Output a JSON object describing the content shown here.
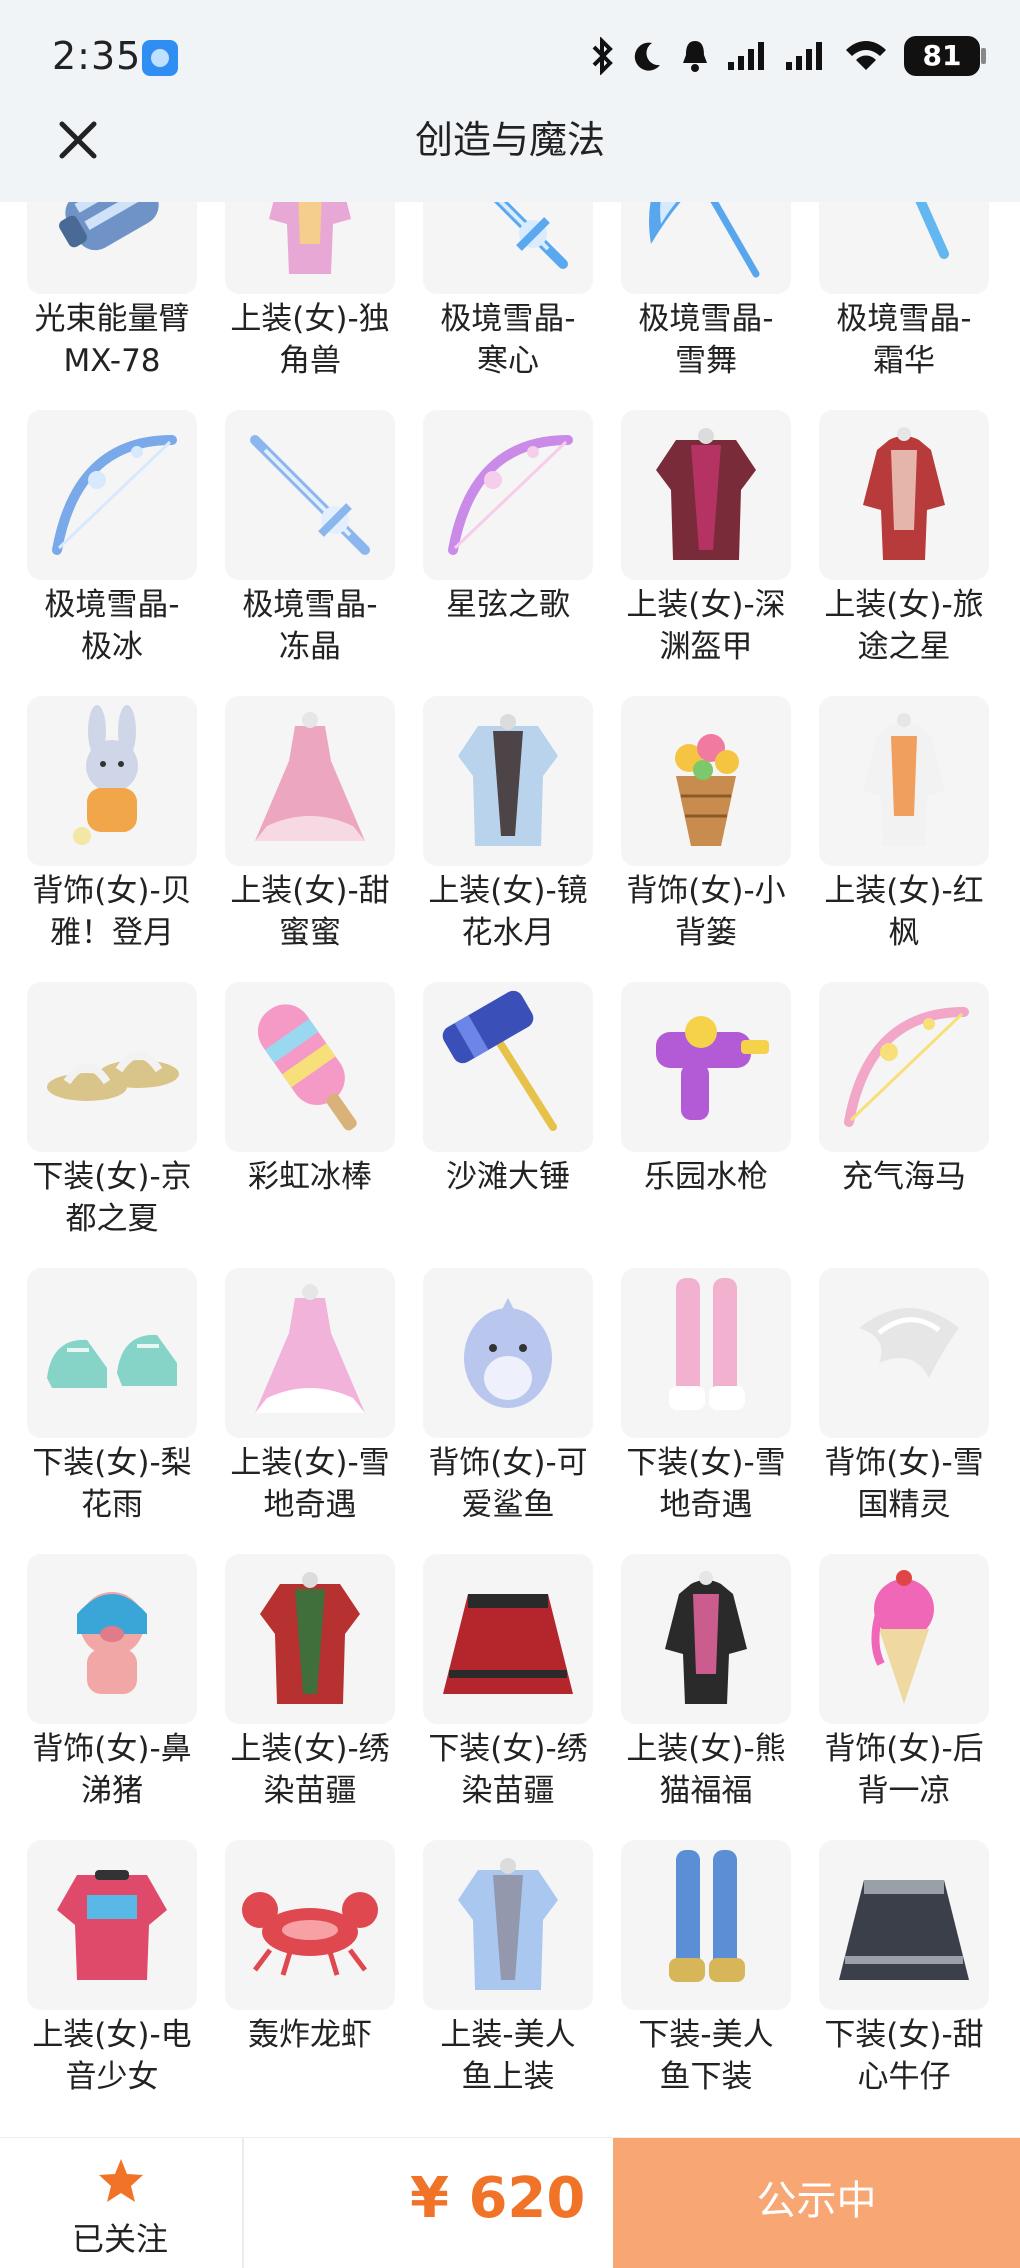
{
  "status_bar": {
    "time": "2:35",
    "battery": "81"
  },
  "header": {
    "title": "创造与魔法"
  },
  "items": [
    {
      "name": "光束能量臂\nMX-78",
      "icon": "gauntlet",
      "color": "#6f93c6",
      "accent": "#cfe2f7"
    },
    {
      "name": "上装(女)-独\n角兽",
      "icon": "outfit",
      "color": "#e8a8d6",
      "accent": "#f7d77a"
    },
    {
      "name": "极境雪晶-\n寒心",
      "icon": "sword",
      "color": "#5aa8f0",
      "accent": "#d9ecff"
    },
    {
      "name": "极境雪晶-\n雪舞",
      "icon": "scythe",
      "color": "#58a6ee",
      "accent": "#d6eaff"
    },
    {
      "name": "极境雪晶-\n霜华",
      "icon": "crossbow",
      "color": "#62b7f0",
      "accent": "#d8eefe"
    },
    {
      "name": "极境雪晶-\n极冰",
      "icon": "bow",
      "color": "#7aa9ea",
      "accent": "#d9e9fd"
    },
    {
      "name": "极境雪晶-\n冻晶",
      "icon": "sword",
      "color": "#8bb7ee",
      "accent": "#e3efff"
    },
    {
      "name": "星弦之歌",
      "icon": "bow",
      "color": "#c98ae8",
      "accent": "#f6cdea"
    },
    {
      "name": "上装(女)-深\n渊盔甲",
      "icon": "armor",
      "color": "#7a2b3a",
      "accent": "#c0356a"
    },
    {
      "name": "上装(女)-旅\n途之星",
      "icon": "outfit",
      "color": "#b73b3b",
      "accent": "#f0d4c8"
    },
    {
      "name": "背饰(女)-贝\n雅！登月",
      "icon": "bunny",
      "color": "#cfd6e8",
      "accent": "#f1a64a"
    },
    {
      "name": "上装(女)-甜\n蜜蜜",
      "icon": "dress",
      "color": "#eca6bf",
      "accent": "#f7d9e4"
    },
    {
      "name": "上装(女)-镜\n花水月",
      "icon": "armor",
      "color": "#b9d3ec",
      "accent": "#3a2a2a"
    },
    {
      "name": "背饰(女)-小\n背篓",
      "icon": "basket",
      "color": "#c98c4f",
      "accent": "#f5c542"
    },
    {
      "name": "上装(女)-红\n枫",
      "icon": "outfit",
      "color": "#f2f2f2",
      "accent": "#f08a3a"
    },
    {
      "name": "下装(女)-京\n都之夏",
      "icon": "sandals",
      "color": "#d9c48a",
      "accent": "#f2f2f2"
    },
    {
      "name": "彩虹冰棒",
      "icon": "popsicle",
      "color": "#f59ac6",
      "accent": "#9ad8f0"
    },
    {
      "name": "沙滩大锤",
      "icon": "hammer",
      "color": "#3b4fb8",
      "accent": "#e7c24a"
    },
    {
      "name": "乐园水枪",
      "icon": "watergun",
      "color": "#b35bd6",
      "accent": "#f6d24a"
    },
    {
      "name": "充气海马",
      "icon": "bow",
      "color": "#f2a6c8",
      "accent": "#f7e07a"
    },
    {
      "name": "下装(女)-梨\n花雨",
      "icon": "shoes",
      "color": "#86d3c7",
      "accent": "#e9f7f4"
    },
    {
      "name": "上装(女)-雪\n地奇遇",
      "icon": "dress",
      "color": "#f1b3da",
      "accent": "#ffffff"
    },
    {
      "name": "背饰(女)-可\n爱鲨鱼",
      "icon": "shark",
      "color": "#b9c6ee",
      "accent": "#eef1fb"
    },
    {
      "name": "下装(女)-雪\n地奇遇",
      "icon": "legs",
      "color": "#f2b2cf",
      "accent": "#ffffff"
    },
    {
      "name": "背饰(女)-雪\n国精灵",
      "icon": "wings",
      "color": "#e6e6e6",
      "accent": "#ffffff"
    },
    {
      "name": "背饰(女)-鼻\n涕猪",
      "icon": "pig",
      "color": "#f2a7a7",
      "accent": "#3aa6d8"
    },
    {
      "name": "上装(女)-绣\n染苗疆",
      "icon": "armor",
      "color": "#b6312f",
      "accent": "#2b7a3e"
    },
    {
      "name": "下装(女)-绣\n染苗疆",
      "icon": "skirt",
      "color": "#b4262b",
      "accent": "#2a2a2a"
    },
    {
      "name": "上装(女)-熊\n猫福福",
      "icon": "outfit",
      "color": "#2a2a2a",
      "accent": "#f26aa8"
    },
    {
      "name": "背饰(女)-后\n背一凉",
      "icon": "icecream",
      "color": "#f067b7",
      "accent": "#f0d9a0"
    },
    {
      "name": "上装(女)-电\n音少女",
      "icon": "jacket",
      "color": "#e04a6a",
      "accent": "#5ab8e6"
    },
    {
      "name": "轰炸龙虾",
      "icon": "lobster",
      "color": "#e0484f",
      "accent": "#f7a1a5"
    },
    {
      "name": "上装-美人\n鱼上装",
      "icon": "armor",
      "color": "#a9c7ef",
      "accent": "#8f8fa0"
    },
    {
      "name": "下装-美人\n鱼下装",
      "icon": "legs",
      "color": "#5a8fd6",
      "accent": "#d7b65a"
    },
    {
      "name": "下装(女)-甜\n心牛仔",
      "icon": "skirt",
      "color": "#3a3f4a",
      "accent": "#9aa0a8"
    }
  ],
  "bottom_bar": {
    "follow_label": "已关注",
    "price": "¥ 620",
    "cta_label": "公示中"
  },
  "colors": {
    "accent": "#f07328",
    "cta_bg": "#f9a675",
    "header_bg": "#f1f4f7"
  }
}
